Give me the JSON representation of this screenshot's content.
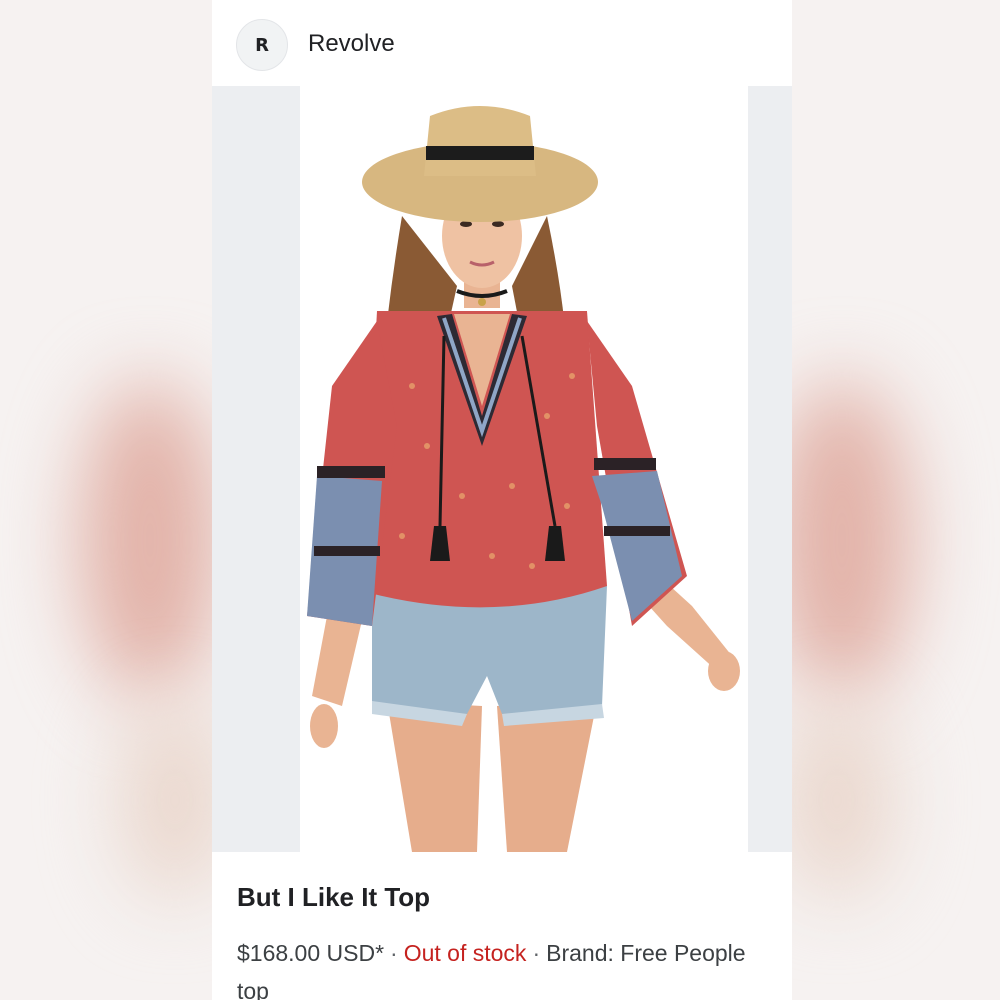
{
  "site": {
    "avatar_letter": "R",
    "name": "Revolve"
  },
  "product": {
    "image_alt": "Model wearing a red boho print peasant top with denim shorts and a straw hat",
    "title": "But I Like It Top",
    "price": "$168.00 USD*",
    "separator": "·",
    "availability": "Out of stock",
    "brand": "Brand: Free People",
    "category": "top"
  },
  "colors": {
    "out_of_stock": "#c5221f",
    "image_background": "#eceef1"
  }
}
